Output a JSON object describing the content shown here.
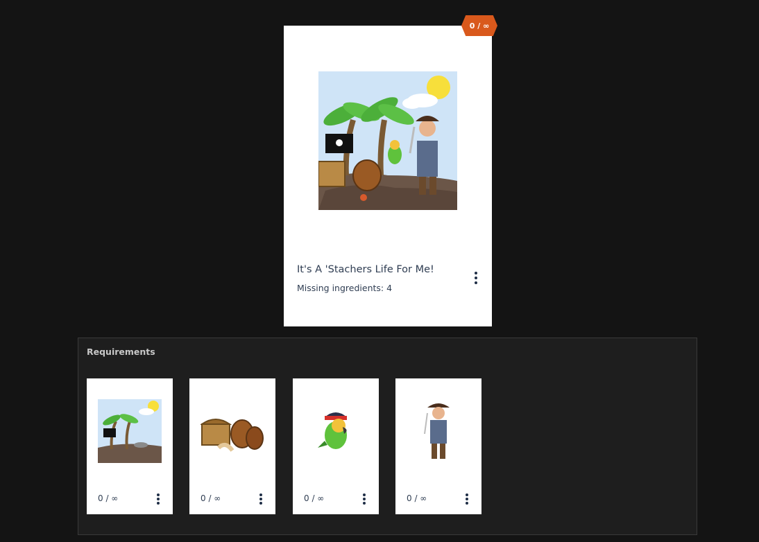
{
  "main_card": {
    "badge": "0 / ∞",
    "image_icon": "pirate-island-scene-icon",
    "title": "It's A 'Stachers Life For Me!",
    "subtitle": "Missing ingredients: 4"
  },
  "requirements": {
    "title": "Requirements",
    "items": [
      {
        "icon": "island-icon",
        "count": "0 / ∞"
      },
      {
        "icon": "treasure-chest-barrels-icon",
        "count": "0 / ∞"
      },
      {
        "icon": "pirate-parrot-icon",
        "count": "0 / ∞"
      },
      {
        "icon": "pirate-captain-icon",
        "count": "0 / ∞"
      }
    ]
  },
  "colors": {
    "background": "#141414",
    "panel": "#1e1e1e",
    "badge": "#d9591c",
    "text": "#2f3d52"
  }
}
